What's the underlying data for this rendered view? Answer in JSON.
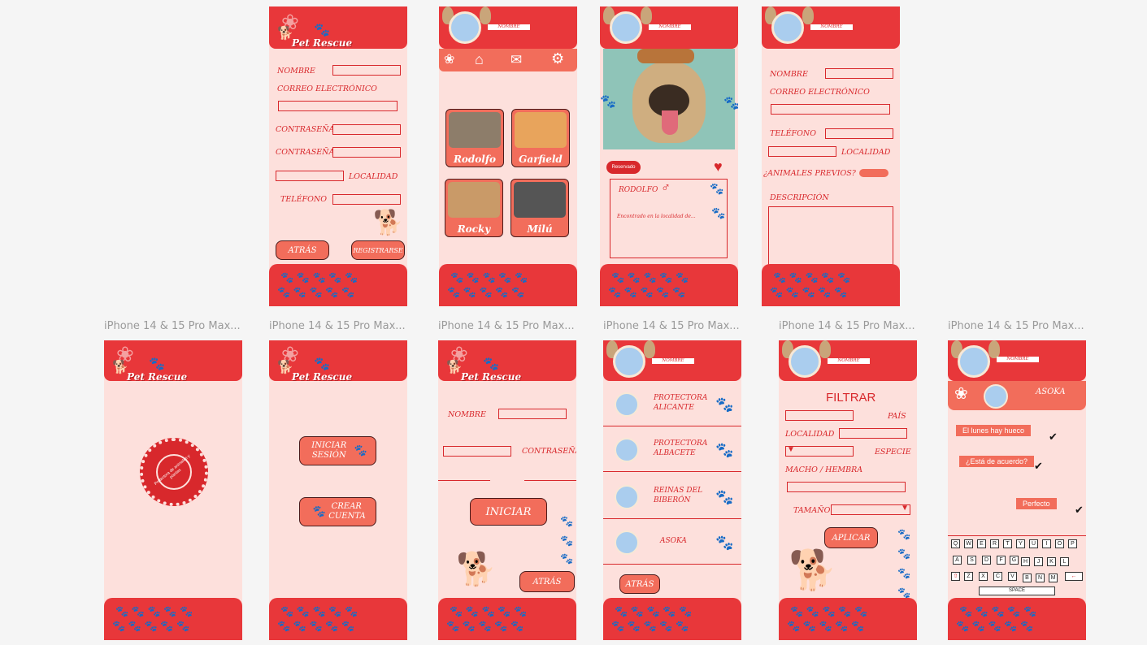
{
  "frame_labels": [
    "iPhone 14 & 15 Pro Max...",
    "iPhone 14 & 15 Pro Max...",
    "iPhone 14 & 15 Pro Max...",
    "iPhone 14 & 15 Pro Max...",
    "iPhone 14 & 15 Pro Max...",
    "iPhone 14 & 15 Pro Max..."
  ],
  "app_logo": "Pet Rescue",
  "profile_name_tag": "NOMBRE",
  "register": {
    "nombre": "NOMBRE",
    "correo": "CORREO ELECTRÓNICO",
    "contrasena1": "CONTRASEÑA",
    "contrasena2": "CONTRASEÑA",
    "localidad": "LOCALIDAD",
    "telefono": "TELÉFONO",
    "atras": "ATRÁS",
    "registrarse": "REGISTRARSE"
  },
  "home": {
    "pets": [
      {
        "name": "Rodolfo",
        "color": "#8d7d6a"
      },
      {
        "name": "Garfield",
        "color": "#e8a45c"
      },
      {
        "name": "Rocky",
        "color": "#c99a68"
      },
      {
        "name": "Milú",
        "color": "#555555"
      }
    ]
  },
  "detail": {
    "reservado": "Reservado",
    "pet_name": "RODOLFO",
    "gender_icon": "♂",
    "description": "Encontrado en la localidad de..."
  },
  "profile": {
    "nombre": "NOMBRE",
    "correo": "CORREO ELECTRÓNICO",
    "telefono": "TELÉFONO",
    "localidad": "LOCALIDAD",
    "animales": "¿ANIMALES PREVIOS?",
    "descripcion": "DESCRIPCIÓN"
  },
  "splash": {
    "seal_text": "Protectora de animales y plantas"
  },
  "welcome": {
    "iniciar_sesion": "INICIAR SESIÓN",
    "crear_cuenta": "CREAR CUENTA"
  },
  "login": {
    "nombre": "NOMBRE",
    "contrasena": "CONTRASEÑA",
    "iniciar": "INICIAR",
    "atras": "ATRÁS"
  },
  "protectoras": {
    "items": [
      {
        "name": "PROTECTORA ALICANTE"
      },
      {
        "name": "PROTECTORA ALBACETE"
      },
      {
        "name": "REINAS DEL BIBERÓN"
      },
      {
        "name": "ASOKA"
      }
    ],
    "atras": "ATRÁS"
  },
  "filtrar": {
    "title": "FILTRAR",
    "pais": "PAÍS",
    "localidad": "LOCALIDAD",
    "especie": "ESPECIE",
    "sexo": "MACHO / HEMBRA",
    "tamano": "TAMAÑO",
    "aplicar": "APLICAR"
  },
  "chat": {
    "contact": "ASOKA",
    "messages": [
      {
        "text": "El lunes hay hueco",
        "side": "left"
      },
      {
        "text": "¿Está de acuerdo?",
        "side": "left"
      },
      {
        "text": "Perfecto",
        "side": "right"
      }
    ],
    "keyboard_rows": [
      [
        "Q",
        "W",
        "E",
        "R",
        "T",
        "Y",
        "U",
        "I",
        "O",
        "P"
      ],
      [
        "A",
        "S",
        "D",
        "F",
        "G",
        "H",
        "J",
        "K",
        "L"
      ],
      [
        "Z",
        "X",
        "C",
        "V",
        "B",
        "N",
        "M"
      ]
    ],
    "space": "SPACE"
  },
  "colors": {
    "primary": "#e8373a",
    "accent": "#f26d5b",
    "bg": "#fde0dc"
  }
}
